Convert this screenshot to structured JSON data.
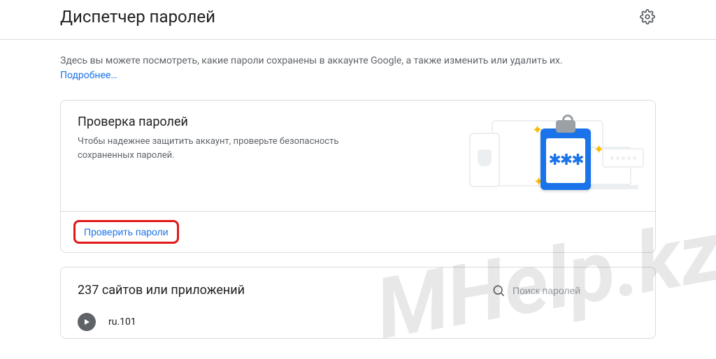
{
  "header": {
    "title": "Диспетчер паролей"
  },
  "intro": {
    "text": "Здесь вы можете посмотреть, какие пароли сохранены в аккаунте Google, а также изменить или удалить их.",
    "learn_more": "Подробнее…"
  },
  "check_card": {
    "title": "Проверка паролей",
    "desc": "Чтобы надежнее защитить аккаунт, проверьте безопасность сохраненных паролей.",
    "button": "Проверить пароли",
    "clip_mask": "✱✱✱"
  },
  "list_card": {
    "title": "237 сайтов или приложений",
    "search_placeholder": "Поиск паролей",
    "items": [
      {
        "name": "ru.101"
      }
    ]
  },
  "watermark": "MHelp.kz"
}
